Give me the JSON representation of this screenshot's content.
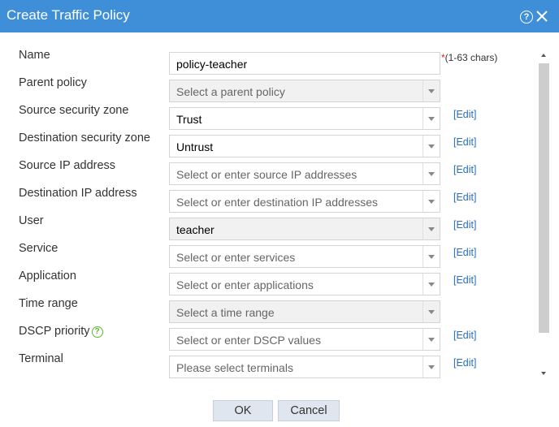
{
  "dialog": {
    "title": "Create Traffic Policy",
    "help_glyph": "?",
    "edit_label": "[Edit]",
    "required_hint": "(1-63 chars)",
    "required_star": "*",
    "help_glyph_small": "?",
    "fields": [
      {
        "label": "Name",
        "value": "policy-teacher",
        "is_value": true
      },
      {
        "label": "Parent policy",
        "value": "Select a parent policy",
        "is_value": false
      },
      {
        "label": "Source security zone",
        "value": "Trust",
        "is_value": true
      },
      {
        "label": "Destination security zone",
        "value": "Untrust",
        "is_value": true
      },
      {
        "label": "Source IP address",
        "value": "Select or enter source IP addresses",
        "is_value": false
      },
      {
        "label": "Destination IP address",
        "value": "Select or enter destination IP addresses",
        "is_value": false
      },
      {
        "label": "User",
        "value": "teacher",
        "is_value": true
      },
      {
        "label": "Service",
        "value": "Select or enter services",
        "is_value": false
      },
      {
        "label": "Application",
        "value": "Select or enter applications",
        "is_value": false
      },
      {
        "label": "Time range",
        "value": "Select a time range",
        "is_value": false
      },
      {
        "label": "DSCP priority",
        "value": "Select or enter DSCP values",
        "is_value": false
      },
      {
        "label": "Terminal",
        "value": "Please select terminals",
        "is_value": false
      }
    ],
    "ok_label": "OK",
    "cancel_label": "Cancel"
  },
  "colors": {
    "titlebar": "#3f8fd8",
    "link": "#2a6fbf",
    "required": "#e02020",
    "help_green": "#5fb52a"
  }
}
